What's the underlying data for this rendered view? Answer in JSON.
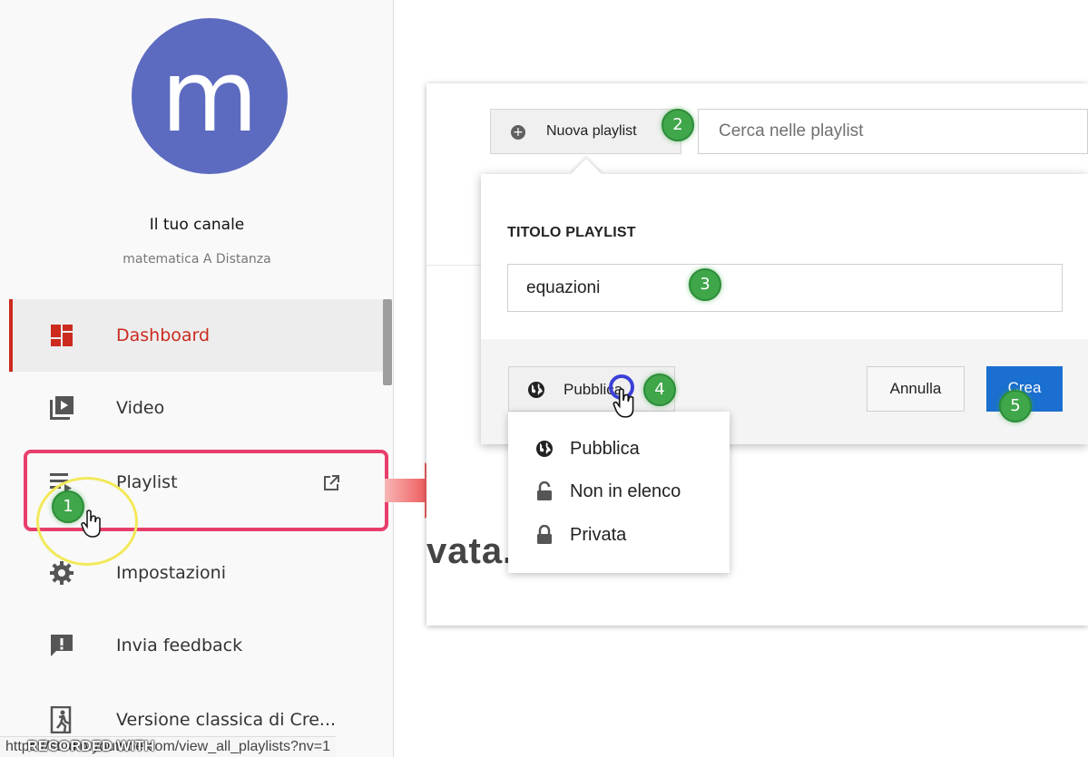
{
  "channel": {
    "avatar_letter": "m",
    "title": "Il tuo canale",
    "subtitle": "matematica A Distanza"
  },
  "sidebar": {
    "items": [
      {
        "label": "Dashboard",
        "icon": "dashboard-icon",
        "active": true
      },
      {
        "label": "Video",
        "icon": "video-icon"
      },
      {
        "label": "Playlist",
        "icon": "playlist-icon"
      },
      {
        "label": "Impostazioni",
        "icon": "gear-icon"
      },
      {
        "label": "Invia feedback",
        "icon": "feedback-icon"
      },
      {
        "label": "Versione classica di Cre...",
        "icon": "exit-icon"
      }
    ]
  },
  "toolbar": {
    "new_playlist_label": "Nuova playlist",
    "search_placeholder": "Cerca nelle playlist"
  },
  "dialog": {
    "title_label": "TITOLO PLAYLIST",
    "title_value": "equazioni",
    "privacy_selected": "Pubblica",
    "cancel_label": "Annulla",
    "create_label": "Crea"
  },
  "privacy_options": [
    {
      "label": "Pubblica",
      "icon": "globe-icon"
    },
    {
      "label": "Non in elenco",
      "icon": "unlock-icon"
    },
    {
      "label": "Privata",
      "icon": "lock-icon"
    }
  ],
  "background_text": "vata.",
  "steps": [
    "1",
    "2",
    "3",
    "4",
    "5"
  ],
  "status_url": "https://studio.youtube.com/view_all_playlists?nv=1",
  "watermark": "RECORDED WITH",
  "colors": {
    "accent_red": "#cc2a1f",
    "create_blue": "#1a6fd0",
    "avatar": "#5c6bc0",
    "step_green": "#3fa64a",
    "highlight_pink": "#e83e6b"
  }
}
